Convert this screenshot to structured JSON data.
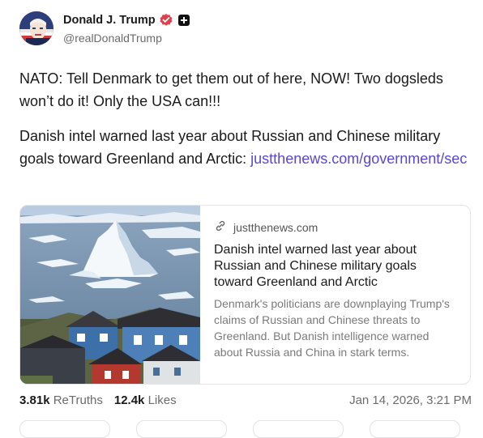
{
  "author": {
    "display_name": "Donald J. Trump",
    "handle": "@realDonaldTrump",
    "avatar_icon": "avatar-image",
    "verified_icon": "verified-badge-icon",
    "plus_icon": "plus-icon"
  },
  "post": {
    "paragraph1": "NATO: Tell Denmark to get them out of here, NOW! Two dogsleds won’t do it! Only the USA can!!!",
    "paragraph2_text": "Danish intel warned last year about Russian and Chinese military goals toward Greenland and Arctic: ",
    "paragraph2_link": "justthenews.com/government/sec"
  },
  "card": {
    "domain": "justthenews.com",
    "title": "Danish intel warned last year about Russian and Chinese military goals toward Greenland and Arctic",
    "description": "Denmark's politicians are downplaying Trump's claims of Russian and Chinese threats to Greenland. But Danish intelligence warned about Russia and China in stark terms.",
    "link_icon": "link-icon",
    "image": "greenland-icebergs-photo"
  },
  "stats": {
    "retruths_count": "3.81k",
    "retruths_label": "ReTruths",
    "likes_count": "12.4k",
    "likes_label": "Likes",
    "timestamp": "Jan 14, 2026, 3:21 PM"
  },
  "colors": {
    "link": "#5747d1",
    "verified": "#e0404b",
    "muted": "#6b6b6b"
  }
}
